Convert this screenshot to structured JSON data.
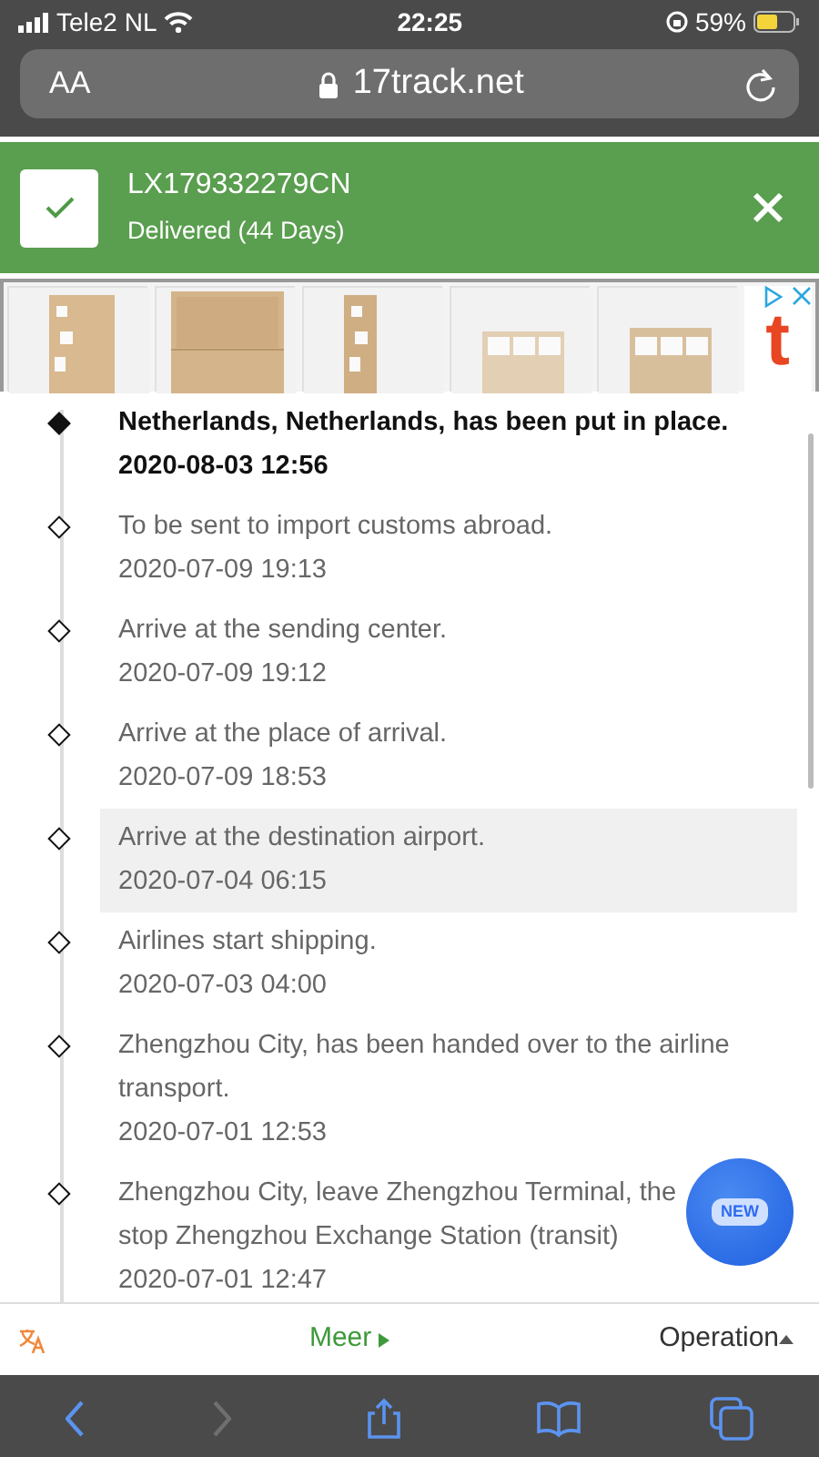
{
  "status_bar": {
    "carrier": "Tele2 NL",
    "time": "22:25",
    "battery": "59%"
  },
  "address_bar": {
    "text_size": "AA",
    "url": "17track.net"
  },
  "banner": {
    "tracking_number": "LX179332279CN",
    "status": "Delivered (44 Days)"
  },
  "ad": {
    "logo": "t"
  },
  "events": [
    {
      "text": "Netherlands, Netherlands, has been put in place.",
      "time": "2020-08-03 12:56",
      "latest": true,
      "highlighted": false
    },
    {
      "text": "To be sent to import customs abroad.",
      "time": "2020-07-09 19:13",
      "latest": false,
      "highlighted": false
    },
    {
      "text": "Arrive at the sending center.",
      "time": "2020-07-09 19:12",
      "latest": false,
      "highlighted": false
    },
    {
      "text": "Arrive at the place of arrival.",
      "time": "2020-07-09 18:53",
      "latest": false,
      "highlighted": false
    },
    {
      "text": "Arrive at the destination airport.",
      "time": "2020-07-04 06:15",
      "latest": false,
      "highlighted": true
    },
    {
      "text": "Airlines start shipping.",
      "time": "2020-07-03 04:00",
      "latest": false,
      "highlighted": false
    },
    {
      "text": "Zhengzhou City, has been handed over to the airline transport.",
      "time": "2020-07-01 12:53",
      "latest": false,
      "highlighted": false
    },
    {
      "text": "Zhengzhou City, leave Zhengzhou Terminal, the stop Zhengzhou Exchange Station (transit)",
      "time": "2020-07-01 12:47",
      "latest": false,
      "highlighted": false
    }
  ],
  "new_button": "NEW",
  "footer": {
    "more": "Meer",
    "operation": "Operation"
  },
  "toolbar": [
    {
      "kind": "back",
      "disabled": false
    },
    {
      "kind": "forward",
      "disabled": true
    },
    {
      "kind": "share",
      "disabled": false
    },
    {
      "kind": "bookmarks",
      "disabled": false
    },
    {
      "kind": "tabs",
      "disabled": false
    }
  ]
}
